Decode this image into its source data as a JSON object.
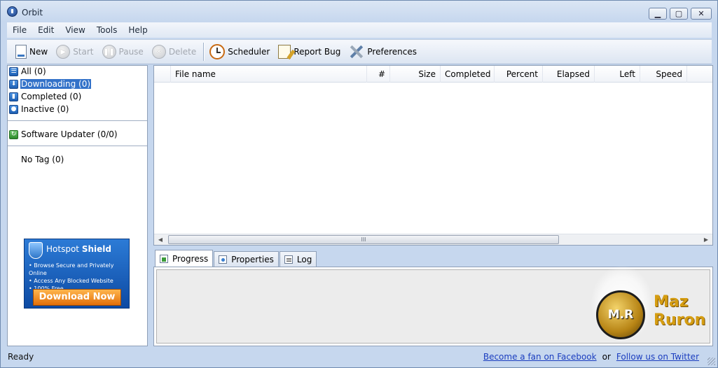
{
  "window": {
    "title": "Orbit",
    "caption_buttons": {
      "minimize": "▁",
      "maximize": "▢",
      "close": "✕"
    }
  },
  "menu": [
    "File",
    "Edit",
    "View",
    "Tools",
    "Help"
  ],
  "toolbar": {
    "new": "New",
    "start": "Start",
    "pause": "Pause",
    "delete": "Delete",
    "scheduler": "Scheduler",
    "report_bug": "Report Bug",
    "preferences": "Preferences"
  },
  "sidebar": {
    "categories": [
      {
        "label": "All (0)",
        "icon": "list-icon"
      },
      {
        "label": "Downloading (0)",
        "icon": "download-arrow-icon",
        "selected": true
      },
      {
        "label": "Completed (0)",
        "icon": "completed-icon"
      },
      {
        "label": "Inactive (0)",
        "icon": "inactive-icon"
      }
    ],
    "software_updater": "Software Updater (0/0)",
    "no_tag": "No Tag (0)"
  },
  "ad": {
    "brand_light": "Hotspot",
    "brand_bold": "Shield",
    "bullets": [
      "• Browse Secure and Privately Online",
      "• Access Any Blocked Website",
      "• 100% Free"
    ],
    "cta": "Download Now"
  },
  "grid": {
    "columns": [
      "File name",
      "#",
      "Size",
      "Completed",
      "Percent",
      "Elapsed",
      "Left",
      "Speed"
    ],
    "scroll_thumb_grip": "III",
    "scroll_left": "◀",
    "scroll_right": "▶"
  },
  "tabs": [
    "Progress",
    "Properties",
    "Log"
  ],
  "watermark": {
    "badge": "M.R",
    "line1": "Maz",
    "line2": "Ruron"
  },
  "status": {
    "text": "Ready",
    "facebook_link": "Become a fan on Facebook",
    "separator": "or",
    "twitter_link": "Follow us on Twitter"
  },
  "colors": {
    "selection": "#3372c9",
    "chrome": "#c6d7ee",
    "link": "#1a3dbf"
  }
}
